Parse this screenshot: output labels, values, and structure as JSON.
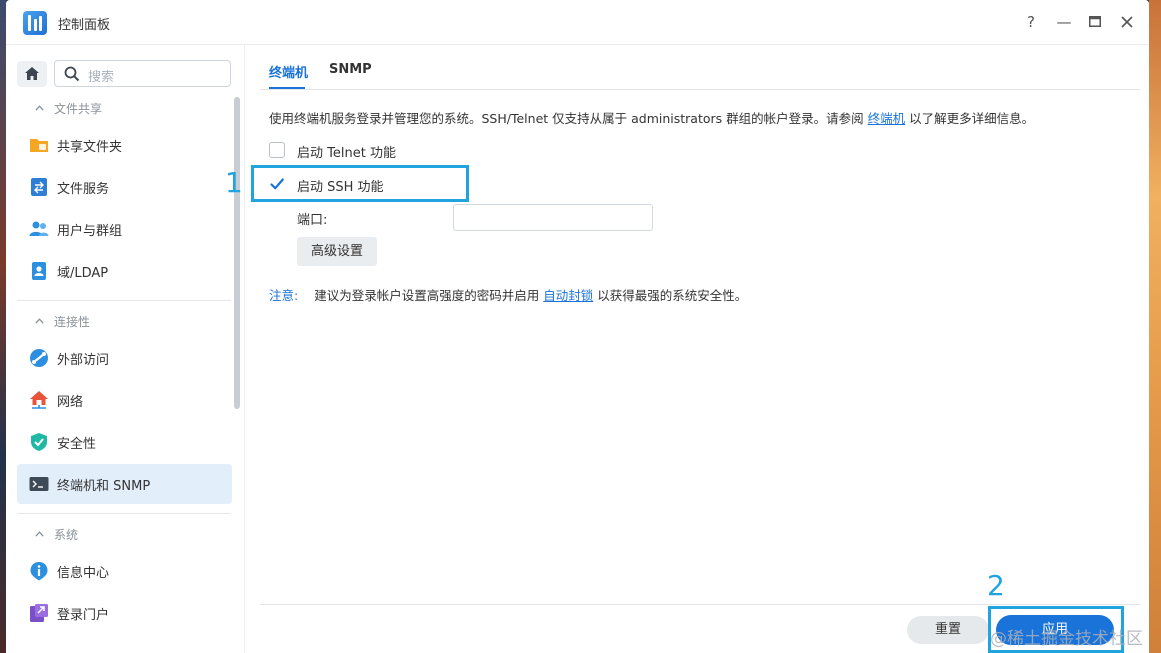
{
  "window": {
    "title": "控制面板",
    "help": "?",
    "minimize": "—",
    "maximize": "□",
    "close": "✕"
  },
  "sidebar": {
    "search_placeholder": "搜索",
    "sections": [
      {
        "title": "文件共享",
        "items": [
          "共享文件夹",
          "文件服务",
          "用户与群组",
          "域/LDAP"
        ]
      },
      {
        "title": "连接性",
        "items": [
          "外部访问",
          "网络",
          "安全性",
          "终端机和 SNMP"
        ]
      },
      {
        "title": "系统",
        "items": [
          "信息中心",
          "登录门户"
        ]
      }
    ],
    "active_item": "终端机和 SNMP"
  },
  "tabs": [
    "终端机",
    "SNMP"
  ],
  "active_tab": "终端机",
  "content": {
    "description_pre": "使用终端机服务登录并管理您的系统。SSH/Telnet 仅支持从属于 administrators 群组的帐户登录。请参阅",
    "description_link": "终端机",
    "description_post": "以了解更多详细信息。",
    "telnet_label": "启动 Telnet 功能",
    "telnet_checked": false,
    "ssh_label": "启动 SSH 功能",
    "ssh_checked": true,
    "port_label": "端口:",
    "port_value": "",
    "advanced_button": "高级设置",
    "note_label": "注意:",
    "note_pre": "建议为登录帐户设置高强度的密码并启用",
    "note_link": "自动封锁",
    "note_post": "以获得最强的系统安全性。"
  },
  "footer": {
    "reset": "重置",
    "apply": "应用"
  },
  "annotations": {
    "step1": "1",
    "step2": "2"
  },
  "watermark": "@稀土掘金技术社区",
  "colors": {
    "accent": "#1a73d9",
    "highlight": "#1fa4e0",
    "active_bg": "#e3eefb"
  }
}
